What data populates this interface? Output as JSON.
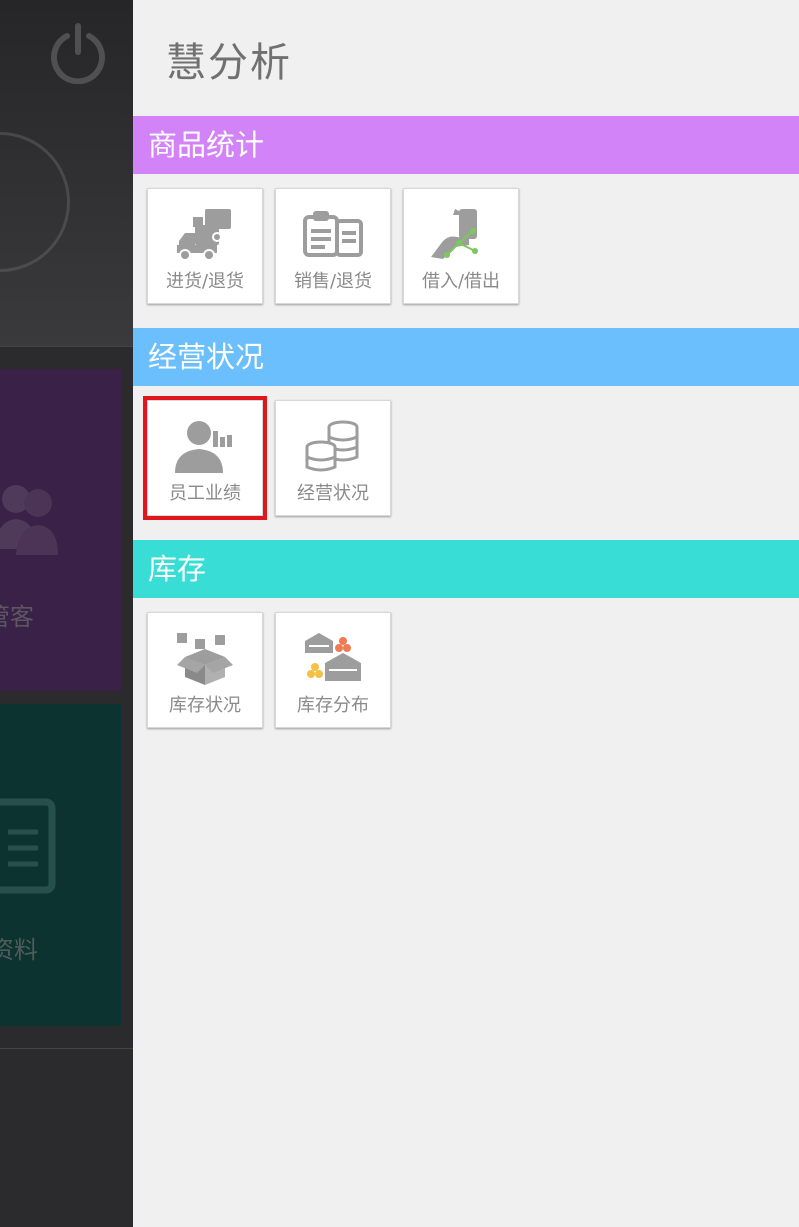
{
  "background_app": {
    "tile_1_label": "管客",
    "tile_2_label": "资料"
  },
  "drawer": {
    "title": "慧分析",
    "sections": [
      {
        "label": "商品统计",
        "color": "#d283f8",
        "items": [
          {
            "label": "进货/退货",
            "icon": "delivery-truck-icon"
          },
          {
            "label": "销售/退货",
            "icon": "clipboard-receipt-icon"
          },
          {
            "label": "借入/借出",
            "icon": "hand-phone-icon"
          }
        ]
      },
      {
        "label": "经营状况",
        "color": "#6bbffd",
        "items": [
          {
            "label": "员工业绩",
            "icon": "employee-chart-icon",
            "selected": true
          },
          {
            "label": "经营状况",
            "icon": "coin-stacks-icon"
          }
        ]
      },
      {
        "label": "库存",
        "color": "#38ddd6",
        "items": [
          {
            "label": "库存状况",
            "icon": "open-box-icon"
          },
          {
            "label": "库存分布",
            "icon": "warehouses-icon"
          }
        ]
      }
    ],
    "selection_color": "#e0161c"
  }
}
